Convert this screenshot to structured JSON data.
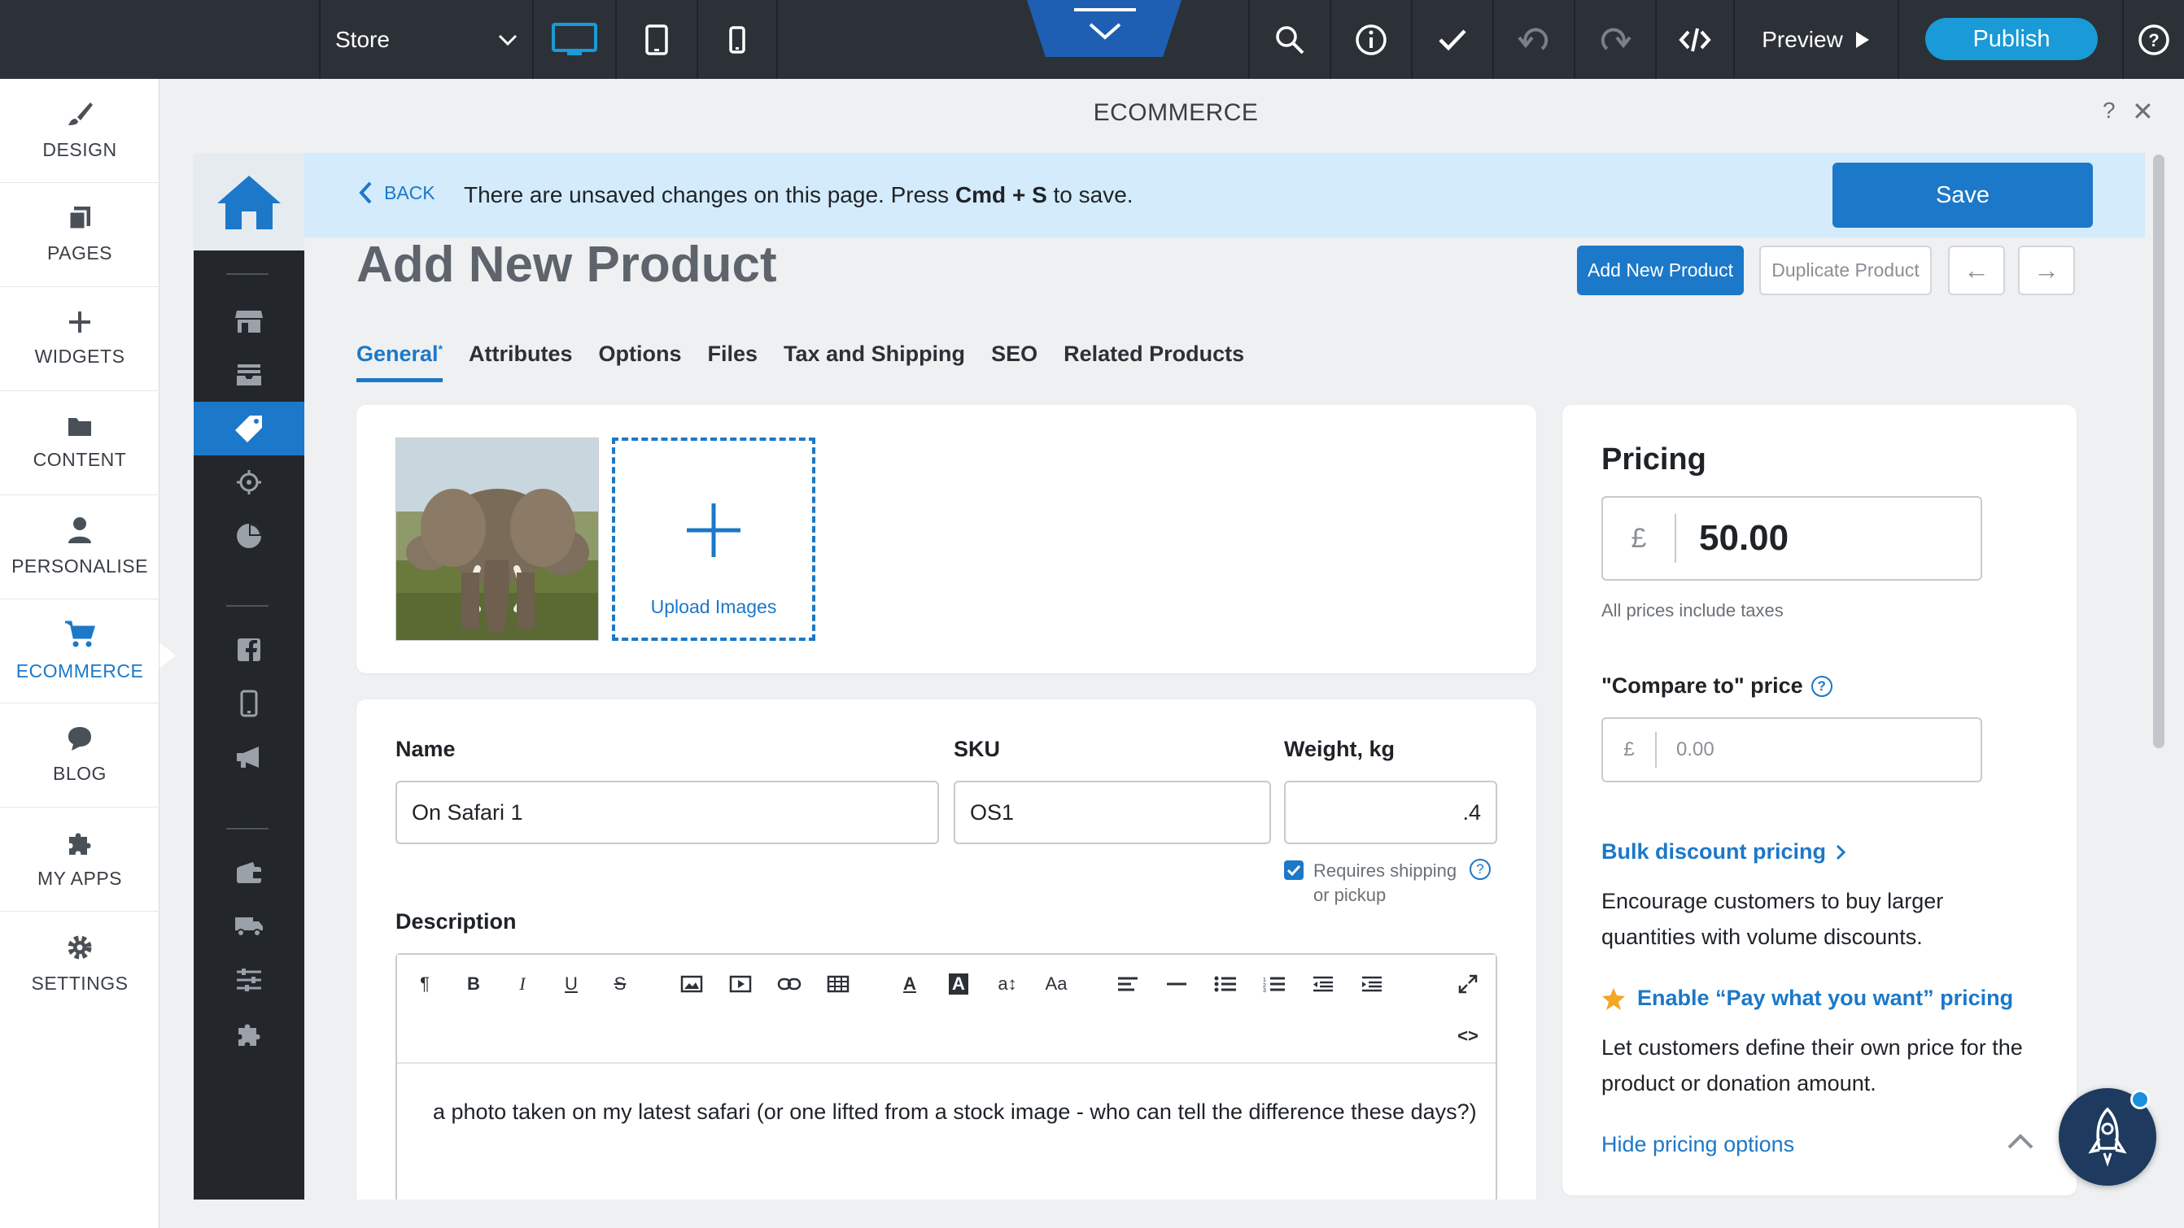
{
  "topbar": {
    "store_label": "Store",
    "preview_label": "Preview",
    "publish_label": "Publish",
    "icons": [
      "chevron-down-icon",
      "desktop-icon",
      "tablet-icon",
      "mobile-icon",
      "search-icon",
      "info-icon",
      "check-icon",
      "undo-icon",
      "redo-icon",
      "code-icon",
      "play-icon",
      "help-icon"
    ]
  },
  "sidebar": {
    "items": [
      {
        "label": "DESIGN",
        "icon": "brush-icon"
      },
      {
        "label": "PAGES",
        "icon": "pages-icon"
      },
      {
        "label": "WIDGETS",
        "icon": "plus-icon"
      },
      {
        "label": "CONTENT",
        "icon": "folder-icon"
      },
      {
        "label": "PERSONALISE",
        "icon": "person-icon"
      },
      {
        "label": "ECOMMERCE",
        "icon": "cart-icon",
        "active": true
      },
      {
        "label": "BLOG",
        "icon": "chat-icon"
      },
      {
        "label": "MY APPS",
        "icon": "puzzle-icon"
      },
      {
        "label": "SETTINGS",
        "icon": "gear-icon"
      }
    ]
  },
  "panel": {
    "title": "ECOMMERCE",
    "help": "?",
    "close": "✕"
  },
  "notice": {
    "back_label": "BACK",
    "text_pre": "There are unsaved changes on this page. Press ",
    "text_key": "Cmd + S",
    "text_post": " to save.",
    "save_label": "Save"
  },
  "product": {
    "heading": "Add New Product",
    "add_new_label": "Add New Product",
    "duplicate_label": "Duplicate Product",
    "prev_arrow": "←",
    "next_arrow": "→",
    "tabs": [
      "General",
      "Attributes",
      "Options",
      "Files",
      "Tax and Shipping",
      "SEO",
      "Related Products"
    ],
    "active_tab_marker": "*",
    "upload_label": "Upload Images",
    "name_label": "Name",
    "name_value": "On Safari 1",
    "sku_label": "SKU",
    "sku_value": "OS1",
    "weight_label": "Weight, kg",
    "weight_value": ".4",
    "requires_shipping": "Requires shipping or pickup",
    "description_label": "Description",
    "description_text": "a photo taken on my latest safari (or one lifted from a stock image - who can tell the difference these days?)"
  },
  "editor_toolbar": {
    "tools": [
      "¶",
      "B",
      "I",
      "U",
      "S",
      "image",
      "video",
      "link",
      "table",
      "A",
      "A",
      "a↕",
      "Aa",
      "align",
      "hr",
      "ul",
      "ol",
      "outdent",
      "indent",
      "expand"
    ],
    "code_toggle": "<>"
  },
  "pricing": {
    "heading": "Pricing",
    "currency": "£",
    "price": "50.00",
    "tax_note": "All prices include taxes",
    "compare_label": "\"Compare to\" price",
    "compare_placeholder": "0.00",
    "bulk_link": "Bulk discount pricing",
    "bulk_desc": "Encourage customers to buy larger quantities with volume discounts.",
    "pwyw_link": "Enable “Pay what you want” pricing",
    "pwyw_desc": "Let customers define their own price for the product or donation amount.",
    "hide_link": "Hide pricing options"
  },
  "colors": {
    "accent": "#1c78c8",
    "topbar": "#2b3137",
    "rail": "#23272c",
    "notice": "#d3ebfb",
    "publish": "#1a9ad6",
    "star": "#f5a623"
  }
}
